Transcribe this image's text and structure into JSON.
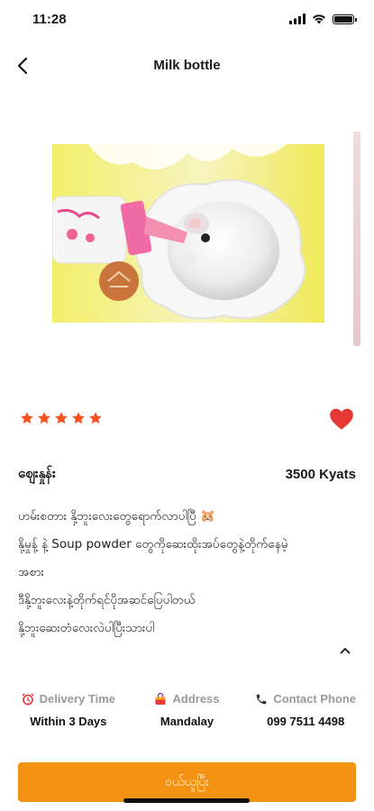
{
  "status_bar": {
    "time": "11:28"
  },
  "nav": {
    "title": "Milk bottle"
  },
  "product": {
    "rating": 5,
    "favorited": true,
    "price_label": "ဈေးနှုန်း",
    "price_value": "3500 Kyats",
    "description": [
      "ဟမ်းစတား နို့ဘူးလေးတွေရောက်လာပါပြီ 🐹",
      "နို့မှုန့် နဲ့ Soup powder တွေကိုဆေးထိုးအပ်တွေနဲ့တိုက်နေမဲ့",
      "အစား",
      "ဒီနို့ဘူးလေးနဲ့တိုက်ရင်ပိုအဆင်ပြေပါတယ်",
      "နို့ဘူးဆေးတံလေးလဲပါပြီးသားပါ"
    ]
  },
  "info": {
    "delivery_label": "Delivery Time",
    "delivery_value": "Within 3 Days",
    "address_label": "Address",
    "address_value": "Mandalay",
    "phone_label": "Contact Phone",
    "phone_value": "099 7511 4498"
  },
  "cta": {
    "label": "ဝယ်ယူပြီး"
  },
  "colors": {
    "accent": "#f39212",
    "star": "#f4511e",
    "heart": "#e53935"
  },
  "icons": [
    "back-chevron-icon",
    "signal-icon",
    "wifi-icon",
    "battery-icon",
    "star-icon",
    "heart-icon",
    "chevron-up-icon",
    "alarm-clock-icon",
    "shopping-bag-icon",
    "phone-icon"
  ]
}
